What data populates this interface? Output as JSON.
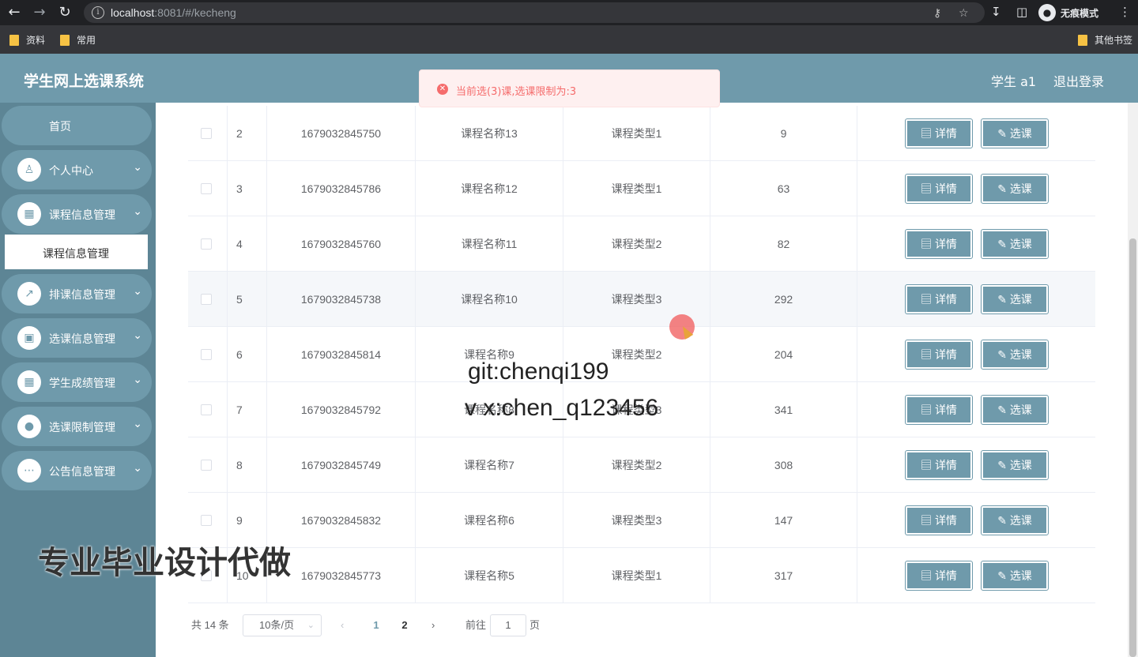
{
  "browser": {
    "url_host": "localhost",
    "url_path": ":8081/#/kecheng",
    "incognito_label": "无痕模式",
    "bookmarks": [
      "资料",
      "常用"
    ],
    "other_bookmarks": "其他书签"
  },
  "header": {
    "title": "学生网上选课系统",
    "user_label": "学生 a1",
    "logout": "退出登录"
  },
  "toast": {
    "message": "当前选(3)课,选课限制为:3"
  },
  "sidebar": {
    "home": "首页",
    "items": [
      {
        "label": "个人中心",
        "icon": "user-icon"
      },
      {
        "label": "课程信息管理",
        "icon": "grid-icon"
      },
      {
        "label": "排课信息管理",
        "icon": "chart-icon"
      },
      {
        "label": "选课信息管理",
        "icon": "monitor-icon"
      },
      {
        "label": "学生成绩管理",
        "icon": "grid-icon"
      },
      {
        "label": "选课限制管理",
        "icon": "bulb-icon"
      },
      {
        "label": "公告信息管理",
        "icon": "chat-icon"
      }
    ],
    "submenu_active": "课程信息管理"
  },
  "table": {
    "detail_label": "详情",
    "select_label": "选课",
    "rows": [
      {
        "idx": "2",
        "code": "1679032845750",
        "name": "课程名称13",
        "type": "课程类型1",
        "num": "9"
      },
      {
        "idx": "3",
        "code": "1679032845786",
        "name": "课程名称12",
        "type": "课程类型1",
        "num": "63"
      },
      {
        "idx": "4",
        "code": "1679032845760",
        "name": "课程名称11",
        "type": "课程类型2",
        "num": "82"
      },
      {
        "idx": "5",
        "code": "1679032845738",
        "name": "课程名称10",
        "type": "课程类型3",
        "num": "292"
      },
      {
        "idx": "6",
        "code": "1679032845814",
        "name": "课程名称9",
        "type": "课程类型2",
        "num": "204"
      },
      {
        "idx": "7",
        "code": "1679032845792",
        "name": "课程名称8",
        "type": "课程类型3",
        "num": "341"
      },
      {
        "idx": "8",
        "code": "1679032845749",
        "name": "课程名称7",
        "type": "课程类型2",
        "num": "308"
      },
      {
        "idx": "9",
        "code": "1679032845832",
        "name": "课程名称6",
        "type": "课程类型3",
        "num": "147"
      },
      {
        "idx": "10",
        "code": "1679032845773",
        "name": "课程名称5",
        "type": "课程类型1",
        "num": "317"
      }
    ]
  },
  "pagination": {
    "total": "共 14 条",
    "page_size": "10条/页",
    "pages": [
      "1",
      "2"
    ],
    "current_page": "1",
    "goto_prefix": "前往",
    "goto_value": "1",
    "goto_suffix": "页"
  },
  "overlay": {
    "git": "git:chenqi199",
    "vx": "v x:chen_q123456",
    "ad": "专业毕业设计代做"
  }
}
